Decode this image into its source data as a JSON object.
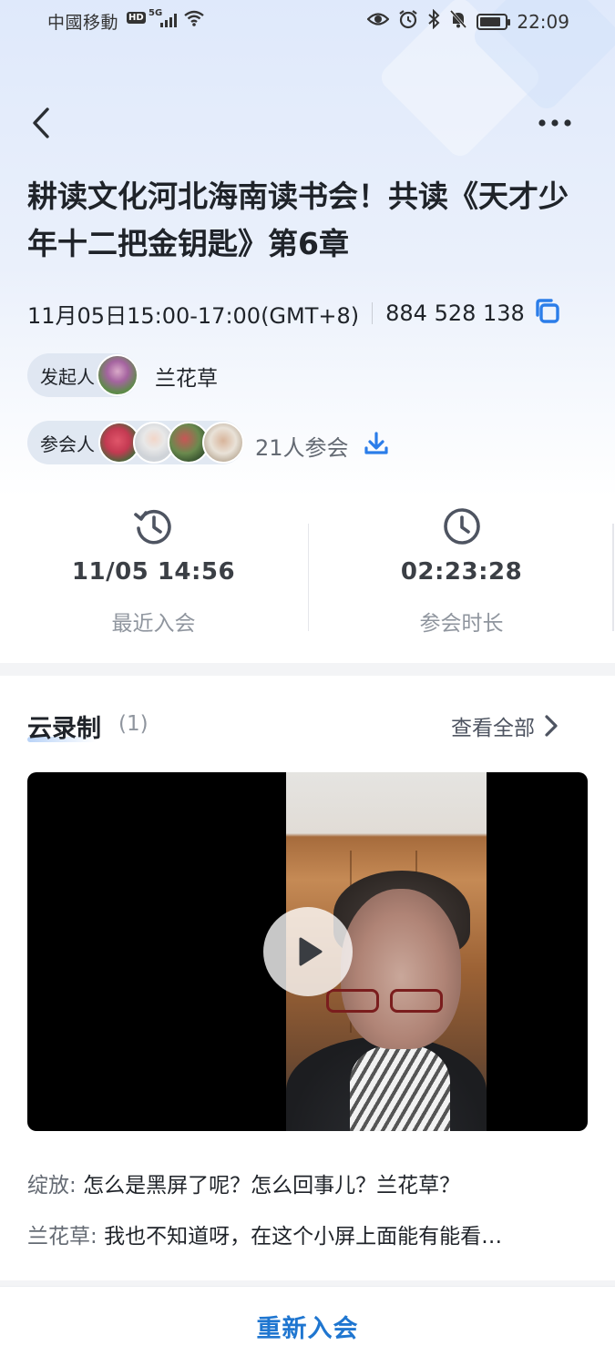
{
  "status_bar": {
    "carrier": "中國移動",
    "hd_badge": "HD",
    "network": "5G",
    "time": "22:09",
    "icons": [
      "eye-icon",
      "alarm-icon",
      "bluetooth-icon",
      "mute-icon",
      "battery-icon"
    ]
  },
  "nav": {
    "back_icon": "chevron-left-icon",
    "more_icon": "more-horizontal-icon"
  },
  "meeting": {
    "title": "耕读文化河北海南读书会！共读《天才少年十二把金钥匙》第6章",
    "time_range": "11月05日15:00-17:00(GMT+8)",
    "meeting_id": "884 528 138",
    "copy_icon": "copy-icon",
    "host_label": "发起人",
    "host_name": "兰花草",
    "participants_label": "参会人",
    "participants_count": "21人参会",
    "download_icon": "download-icon"
  },
  "stats": {
    "last_join_value": "11/05 14:56",
    "last_join_label": "最近入会",
    "duration_value": "02:23:28",
    "duration_label": "参会时长"
  },
  "recording": {
    "title": "云录制",
    "count": "(1)",
    "view_all": "查看全部",
    "play_icon": "play-icon"
  },
  "transcript": [
    {
      "sender": "绽放:",
      "text": "怎么是黑屏了呢？怎么回事儿？兰花草？"
    },
    {
      "sender": "兰花草:",
      "text": "我也不知道呀，在这个小屏上面能有能看…"
    }
  ],
  "bottom": {
    "rejoin": "重新入会"
  },
  "colors": {
    "accent": "#1f76d0",
    "icon_blue": "#2b7de9"
  }
}
